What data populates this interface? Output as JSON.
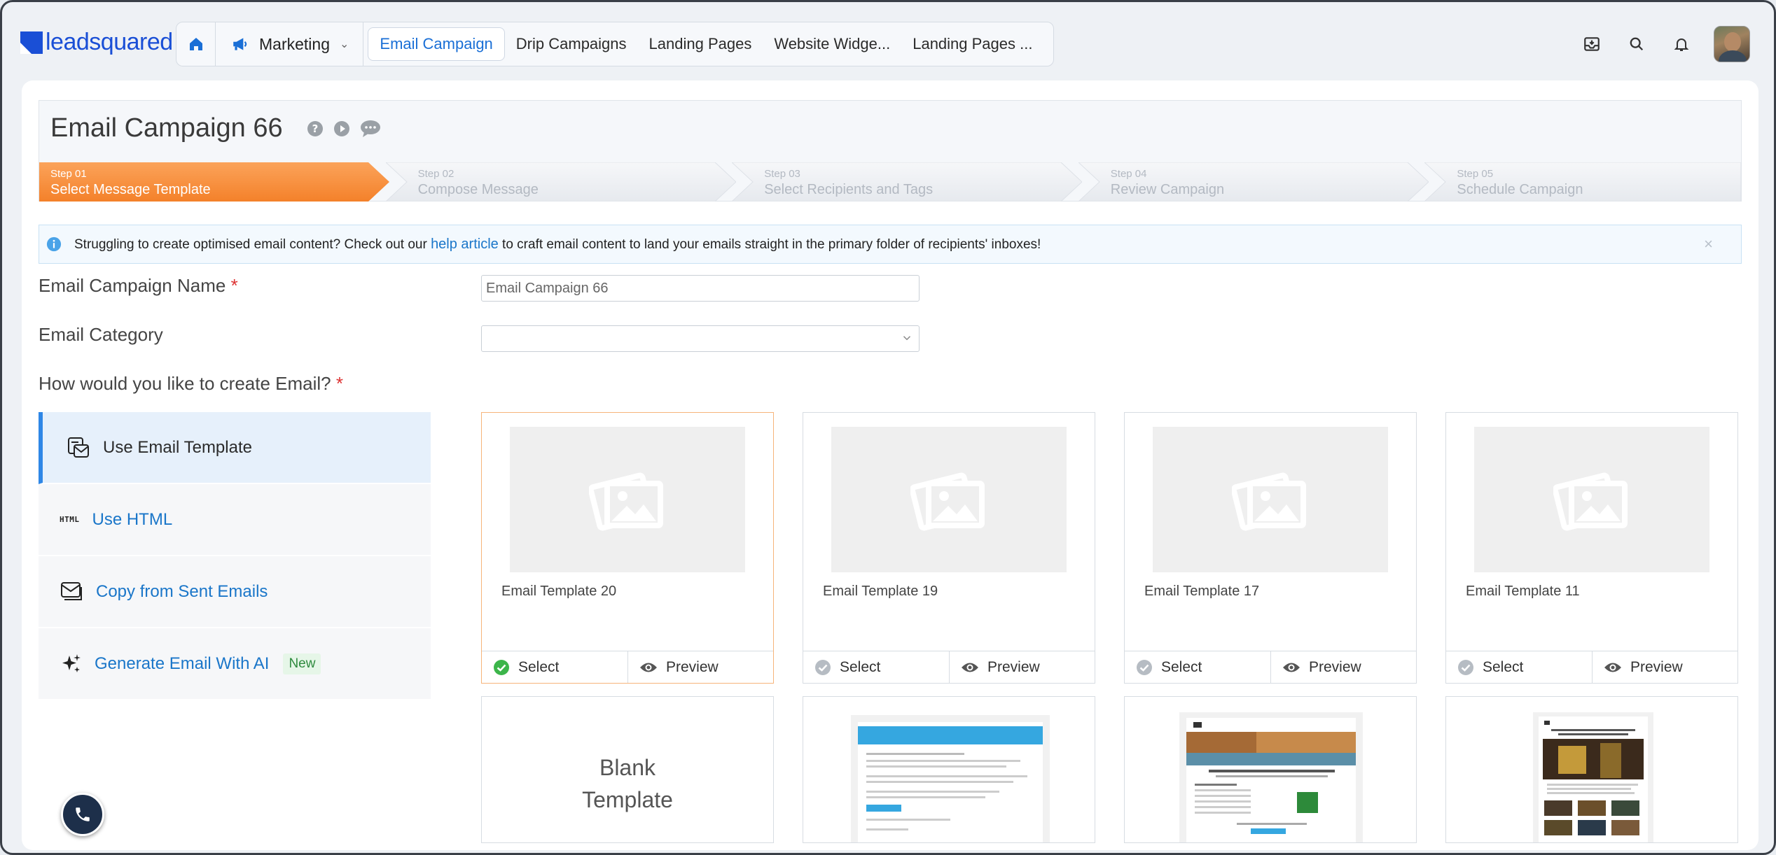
{
  "brand": {
    "logo_text": "leadsquared"
  },
  "nav": {
    "module": "Marketing",
    "tabs": [
      {
        "label": "Email Campaign",
        "active": true
      },
      {
        "label": "Drip Campaigns"
      },
      {
        "label": "Landing Pages"
      },
      {
        "label": "Website Widge..."
      },
      {
        "label": "Landing Pages ..."
      }
    ]
  },
  "header": {
    "title": "Email Campaign 66",
    "steps": [
      {
        "num": "Step 01",
        "name": "Select Message Template",
        "active": true
      },
      {
        "num": "Step 02",
        "name": "Compose Message"
      },
      {
        "num": "Step 03",
        "name": "Select Recipients and Tags"
      },
      {
        "num": "Step 04",
        "name": "Review Campaign"
      },
      {
        "num": "Step 05",
        "name": "Schedule Campaign"
      }
    ]
  },
  "info": {
    "before": "Struggling to create optimised email content? Check out our ",
    "link": "help article",
    "after": " to craft email content to land your emails straight in the primary folder of recipients' inboxes!",
    "close": "×"
  },
  "form": {
    "name_label": "Email Campaign Name",
    "name_value": "Email Campaign 66",
    "category_label": "Email Category",
    "category_value": "",
    "how_label": "How would you like to create Email?",
    "required_mark": "*"
  },
  "options": [
    {
      "label": "Use Email Template",
      "active": true
    },
    {
      "label": "Use HTML",
      "icon_text": "HTML"
    },
    {
      "label": "Copy from Sent Emails"
    },
    {
      "label": "Generate Email With AI",
      "badge": "New"
    }
  ],
  "templates": [
    {
      "name": "Email Template 20",
      "selected": true
    },
    {
      "name": "Email Template 19"
    },
    {
      "name": "Email Template 17"
    },
    {
      "name": "Email Template 11"
    }
  ],
  "template_actions": {
    "select": "Select",
    "preview": "Preview"
  },
  "blank_template": {
    "line1": "Blank",
    "line2": "Template"
  },
  "colors": {
    "accent": "#1a76c9",
    "step_active": "#f7913d",
    "select_check": "#3cb54a"
  }
}
